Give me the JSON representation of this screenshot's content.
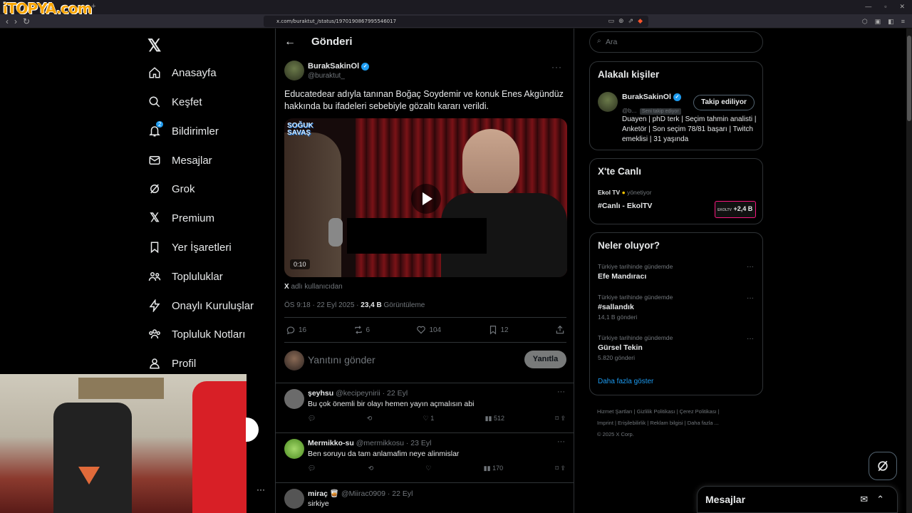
{
  "browser": {
    "watermark": "iTOPYA.com",
    "new_tab": "+",
    "url": "x.com/buraktut_/status/1970190867995546017",
    "nav": [
      "‹",
      "›",
      "↻"
    ],
    "window_controls": [
      "—",
      "▫",
      "✕"
    ]
  },
  "sidebar": {
    "logo": "𝕏",
    "notification_badge": "2",
    "items": [
      {
        "label": "Anasayfa",
        "icon": "home-icon"
      },
      {
        "label": "Keşfet",
        "icon": "search-icon"
      },
      {
        "label": "Bildirimler",
        "icon": "bell-icon"
      },
      {
        "label": "Mesajlar",
        "icon": "mail-icon"
      },
      {
        "label": "Grok",
        "icon": "grok-icon"
      },
      {
        "label": "Premium",
        "icon": "x-icon"
      },
      {
        "label": "Yer İşaretleri",
        "icon": "bookmark-icon"
      },
      {
        "label": "Topluluklar",
        "icon": "communities-icon"
      },
      {
        "label": "Onaylı Kuruluşlar",
        "icon": "lightning-icon"
      },
      {
        "label": "Topluluk Notları",
        "icon": "notes-icon"
      },
      {
        "label": "Profil",
        "icon": "profile-icon"
      }
    ],
    "more_dots": "···"
  },
  "header": {
    "title": "Gönderi",
    "back": "←"
  },
  "post": {
    "author_name": "BurakSakinOl",
    "author_handle": "@buraktut_",
    "more": "···",
    "text": "Educatedear adıyla tanınan Boğaç Soydemir ve konuk Enes Akgündüz hakkında bu ifadeleri sebebiyle gözaltı kararı verildi.",
    "video_time": "0:10",
    "video_logo_1": "SOĞUK",
    "video_logo_2": "SAVAŞ",
    "source_brand": "X",
    "source_text": "adlı kullanıcıdan",
    "time": "ÖS 9:18 · 22 Eyl 2025 · ",
    "views": "23,4 B",
    "views_label": " Görüntüleme",
    "stats": {
      "replies": "16",
      "reposts": "6",
      "likes": "104",
      "bookmarks": "12"
    }
  },
  "reply_box": {
    "placeholder": "Yanıtını gönder",
    "button": "Yanıtla"
  },
  "replies": [
    {
      "name": "şeyhsu",
      "handle": "@kecipeynirii · 22 Eyl",
      "text": "Bu çok önemli bir olayı hemen yayın açmalısın abi",
      "likes": "1",
      "views": "512",
      "avatar_color": "#6b6b6b"
    },
    {
      "name": "Mermikko-su",
      "handle": "@mermikkosu · 23 Eyl",
      "text": "Ben soruyu da tam anlamafim neye alinmislar",
      "likes": "",
      "views": "170",
      "avatar_color": "#7cc243"
    },
    {
      "name": "miraç 🥃",
      "handle": "@Miirac0909 · 22 Eyl",
      "text": "sirkiye",
      "likes": "",
      "views": "",
      "avatar_color": "#555"
    }
  ],
  "search": {
    "placeholder": "Ara"
  },
  "related": {
    "title": "Alakalı kişiler",
    "name": "BurakSakinOl",
    "handle": "@b...",
    "follows_you": "Seni takip ediyor",
    "follow_button": "Takip ediliyor",
    "bio": "Duayen | phD terk | Seçim tahmin analisti | Anketör | Son seçim 78/81 başarı | Twitch emeklisi | 31 yaşında"
  },
  "live": {
    "title": "X'te Canlı",
    "host": "Ekol TV",
    "host_suffix": "yönetiyor",
    "stream": "#Canlı - EkolTV",
    "thumb_brand": "EKOLTV",
    "viewers": "+2,4 B"
  },
  "trends": {
    "title": "Neler oluyor?",
    "items": [
      {
        "context": "Türkiye tarihinde gündemde",
        "name": "Efe Mandıracı",
        "count": ""
      },
      {
        "context": "Türkiye tarihinde gündemde",
        "name": "#sallandık",
        "count": "14,1 B gönderi"
      },
      {
        "context": "Türkiye tarihinde gündemde",
        "name": "Gürsel Tekin",
        "count": "5.820 gönderi"
      }
    ],
    "show_more": "Daha fazla göster"
  },
  "footer": {
    "line1": "Hizmet Şartları  |  Gizlilik Politikası  |  Çerez Politikası  |",
    "line2": "Imprint  |  Erişilebilirlik  |  Reklam bilgisi  |  Daha fazla ...",
    "line3": "© 2025 X Corp."
  },
  "messages_drawer": {
    "title": "Mesajlar"
  },
  "colors": {
    "accent": "#1d9bf0",
    "link": "#1d9bf0",
    "text": "#e7e9ea",
    "muted": "#71767b",
    "border": "#2f3336",
    "live": "#f91880"
  }
}
